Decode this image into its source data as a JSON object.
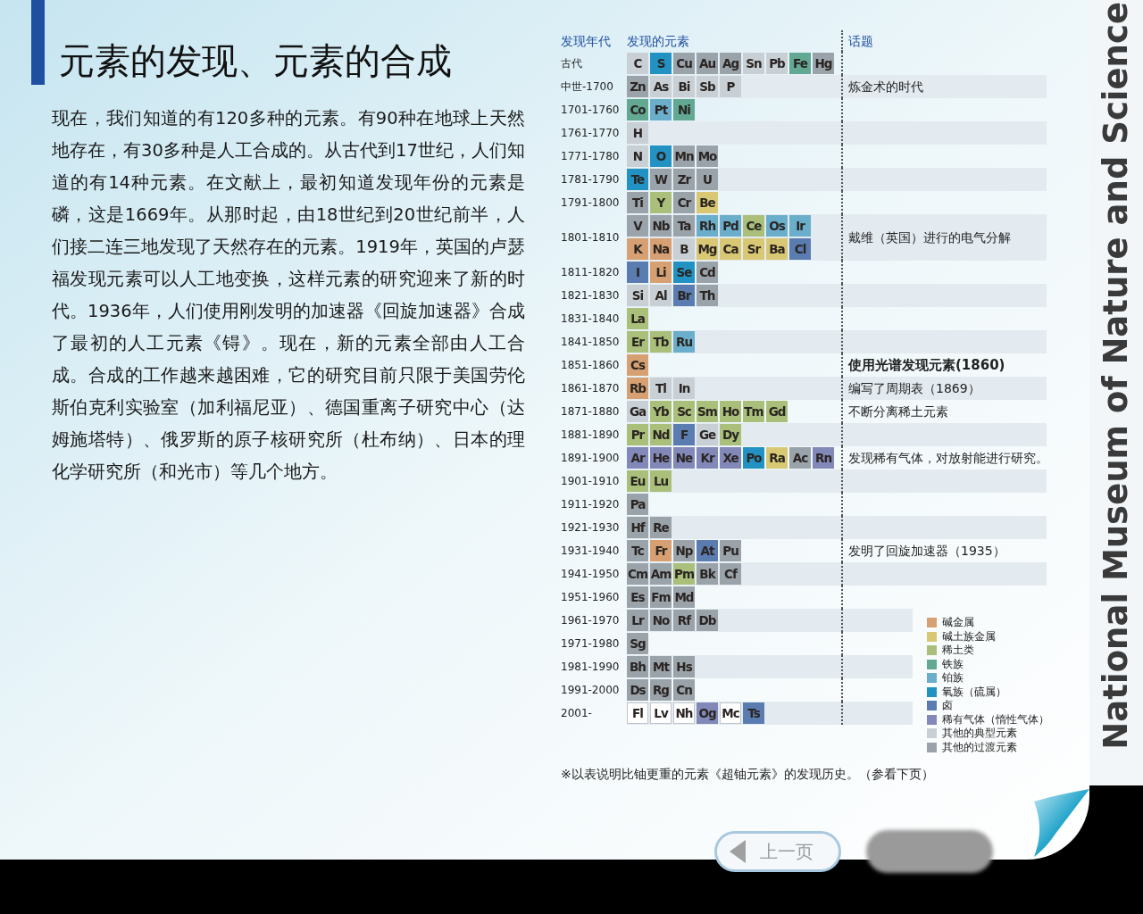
{
  "title": "元素的发现、元素的合成",
  "body": "现在，我们知道的有120多种的元素。有90种在地球上天然地存在，有30多种是人工合成的。从古代到17世纪，人们知道的有14种元素。在文献上，最初知道发现年份的元素是磷，这是1669年。从那时起，由18世纪到20世纪前半，人们接二连三地发现了天然存在的元素。1919年，英国的卢瑟福发现元素可以人工地变换，这样元素的研究迎来了新的时代。1936年，人们使用刚发明的加速器《回旋加速器》合成了最初的人工元素《锝》。现在，新的元素全部由人工合成。合成的工作越来越困难，它的研究目前只限于美国劳伦斯伯克利实验室（加利福尼亚）、德国重离子研究中心（达姆施塔特）、俄罗斯的原子核研究所（杜布纳）、日本的理化学研究所（和光市）等几个地方。",
  "table": {
    "columns": [
      "发现年代",
      "发现的元素",
      "话题"
    ],
    "rows": [
      {
        "era": "古代",
        "lines": [
          [
            {
              "symbol": "C",
              "kind": "typical"
            },
            {
              "symbol": "S",
              "kind": "chalcogen"
            },
            {
              "symbol": "Cu",
              "kind": "transition"
            },
            {
              "symbol": "Au",
              "kind": "transition"
            },
            {
              "symbol": "Ag",
              "kind": "transition"
            },
            {
              "symbol": "Sn",
              "kind": "typical"
            },
            {
              "symbol": "Pb",
              "kind": "typical"
            },
            {
              "symbol": "Fe",
              "kind": "iron"
            },
            {
              "symbol": "Hg",
              "kind": "transition"
            }
          ]
        ]
      },
      {
        "era": "中世-1700",
        "lines": [
          [
            {
              "symbol": "Zn",
              "kind": "transition"
            },
            {
              "symbol": "As",
              "kind": "typical"
            },
            {
              "symbol": "Bi",
              "kind": "typical"
            },
            {
              "symbol": "Sb",
              "kind": "typical"
            },
            {
              "symbol": "P",
              "kind": "typical"
            }
          ]
        ],
        "topic": {
          "text": "炼金术的时代",
          "bold": false
        }
      },
      {
        "era": "1701-1760",
        "lines": [
          [
            {
              "symbol": "Co",
              "kind": "iron"
            },
            {
              "symbol": "Pt",
              "kind": "platinum"
            },
            {
              "symbol": "Ni",
              "kind": "iron"
            }
          ]
        ]
      },
      {
        "era": "1761-1770",
        "lines": [
          [
            {
              "symbol": "H",
              "kind": "typical"
            }
          ]
        ]
      },
      {
        "era": "1771-1780",
        "lines": [
          [
            {
              "symbol": "N",
              "kind": "typical"
            },
            {
              "symbol": "O",
              "kind": "chalcogen"
            },
            {
              "symbol": "Mn",
              "kind": "transition"
            },
            {
              "symbol": "Mo",
              "kind": "transition"
            }
          ]
        ]
      },
      {
        "era": "1781-1790",
        "lines": [
          [
            {
              "symbol": "Te",
              "kind": "chalcogen"
            },
            {
              "symbol": "W",
              "kind": "transition"
            },
            {
              "symbol": "Zr",
              "kind": "transition"
            },
            {
              "symbol": "U",
              "kind": "transition"
            }
          ]
        ]
      },
      {
        "era": "1791-1800",
        "lines": [
          [
            {
              "symbol": "Ti",
              "kind": "transition"
            },
            {
              "symbol": "Y",
              "kind": "rare"
            },
            {
              "symbol": "Cr",
              "kind": "transition"
            },
            {
              "symbol": "Be",
              "kind": "alkaline"
            }
          ]
        ]
      },
      {
        "era": "1801-1810",
        "lines": [
          [
            {
              "symbol": "V",
              "kind": "transition"
            },
            {
              "symbol": "Nb",
              "kind": "transition"
            },
            {
              "symbol": "Ta",
              "kind": "transition"
            },
            {
              "symbol": "Rh",
              "kind": "platinum"
            },
            {
              "symbol": "Pd",
              "kind": "platinum"
            },
            {
              "symbol": "Ce",
              "kind": "rare"
            },
            {
              "symbol": "Os",
              "kind": "platinum"
            },
            {
              "symbol": "Ir",
              "kind": "platinum"
            }
          ],
          [
            {
              "symbol": "K",
              "kind": "alkali"
            },
            {
              "symbol": "Na",
              "kind": "alkali"
            },
            {
              "symbol": "B",
              "kind": "typical"
            },
            {
              "symbol": "Mg",
              "kind": "alkaline"
            },
            {
              "symbol": "Ca",
              "kind": "alkaline"
            },
            {
              "symbol": "Sr",
              "kind": "alkaline"
            },
            {
              "symbol": "Ba",
              "kind": "alkaline"
            },
            {
              "symbol": "Cl",
              "kind": "halogen"
            }
          ]
        ],
        "topic": {
          "text": "戴维（英国）进行的电气分解",
          "bold": false
        }
      },
      {
        "era": "1811-1820",
        "lines": [
          [
            {
              "symbol": "I",
              "kind": "halogen"
            },
            {
              "symbol": "Li",
              "kind": "alkali"
            },
            {
              "symbol": "Se",
              "kind": "chalcogen"
            },
            {
              "symbol": "Cd",
              "kind": "transition"
            }
          ]
        ]
      },
      {
        "era": "1821-1830",
        "lines": [
          [
            {
              "symbol": "Si",
              "kind": "typical"
            },
            {
              "symbol": "Al",
              "kind": "typical"
            },
            {
              "symbol": "Br",
              "kind": "halogen"
            },
            {
              "symbol": "Th",
              "kind": "transition"
            }
          ]
        ]
      },
      {
        "era": "1831-1840",
        "lines": [
          [
            {
              "symbol": "La",
              "kind": "rare"
            }
          ]
        ]
      },
      {
        "era": "1841-1850",
        "lines": [
          [
            {
              "symbol": "Er",
              "kind": "rare"
            },
            {
              "symbol": "Tb",
              "kind": "rare"
            },
            {
              "symbol": "Ru",
              "kind": "platinum"
            }
          ]
        ]
      },
      {
        "era": "1851-1860",
        "lines": [
          [
            {
              "symbol": "Cs",
              "kind": "alkali"
            }
          ]
        ],
        "topic": {
          "text": "使用光谱发现元素(1860)",
          "bold": true
        }
      },
      {
        "era": "1861-1870",
        "lines": [
          [
            {
              "symbol": "Rb",
              "kind": "alkali"
            },
            {
              "symbol": "Tl",
              "kind": "typical"
            },
            {
              "symbol": "In",
              "kind": "typical"
            }
          ]
        ],
        "topic": {
          "text": "编写了周期表（1869）",
          "bold": false
        }
      },
      {
        "era": "1871-1880",
        "lines": [
          [
            {
              "symbol": "Ga",
              "kind": "typical"
            },
            {
              "symbol": "Yb",
              "kind": "rare"
            },
            {
              "symbol": "Sc",
              "kind": "rare"
            },
            {
              "symbol": "Sm",
              "kind": "rare"
            },
            {
              "symbol": "Ho",
              "kind": "rare"
            },
            {
              "symbol": "Tm",
              "kind": "rare"
            },
            {
              "symbol": "Gd",
              "kind": "rare"
            }
          ]
        ],
        "topic": {
          "text": "不断分离稀土元素",
          "bold": false
        }
      },
      {
        "era": "1881-1890",
        "lines": [
          [
            {
              "symbol": "Pr",
              "kind": "rare"
            },
            {
              "symbol": "Nd",
              "kind": "rare"
            },
            {
              "symbol": "F",
              "kind": "halogen"
            },
            {
              "symbol": "Ge",
              "kind": "typical"
            },
            {
              "symbol": "Dy",
              "kind": "rare"
            }
          ]
        ]
      },
      {
        "era": "1891-1900",
        "lines": [
          [
            {
              "symbol": "Ar",
              "kind": "noble"
            },
            {
              "symbol": "He",
              "kind": "noble"
            },
            {
              "symbol": "Ne",
              "kind": "noble"
            },
            {
              "symbol": "Kr",
              "kind": "noble"
            },
            {
              "symbol": "Xe",
              "kind": "noble"
            },
            {
              "symbol": "Po",
              "kind": "chalcogen"
            },
            {
              "symbol": "Ra",
              "kind": "alkaline"
            },
            {
              "symbol": "Ac",
              "kind": "transition"
            },
            {
              "symbol": "Rn",
              "kind": "noble"
            }
          ]
        ],
        "topic": {
          "text": "发现稀有气体，对放射能进行研究。",
          "bold": false
        }
      },
      {
        "era": "1901-1910",
        "lines": [
          [
            {
              "symbol": "Eu",
              "kind": "rare"
            },
            {
              "symbol": "Lu",
              "kind": "rare"
            }
          ]
        ]
      },
      {
        "era": "1911-1920",
        "lines": [
          [
            {
              "symbol": "Pa",
              "kind": "transition"
            }
          ]
        ]
      },
      {
        "era": "1921-1930",
        "lines": [
          [
            {
              "symbol": "Hf",
              "kind": "transition"
            },
            {
              "symbol": "Re",
              "kind": "transition"
            }
          ]
        ]
      },
      {
        "era": "1931-1940",
        "lines": [
          [
            {
              "symbol": "Tc",
              "kind": "transition"
            },
            {
              "symbol": "Fr",
              "kind": "alkali"
            },
            {
              "symbol": "Np",
              "kind": "transition"
            },
            {
              "symbol": "At",
              "kind": "halogen"
            },
            {
              "symbol": "Pu",
              "kind": "transition"
            }
          ]
        ],
        "topic": {
          "text": "发明了回旋加速器（1935）",
          "bold": false
        }
      },
      {
        "era": "1941-1950",
        "lines": [
          [
            {
              "symbol": "Cm",
              "kind": "transition"
            },
            {
              "symbol": "Am",
              "kind": "transition"
            },
            {
              "symbol": "Pm",
              "kind": "rare"
            },
            {
              "symbol": "Bk",
              "kind": "transition"
            },
            {
              "symbol": "Cf",
              "kind": "transition"
            }
          ]
        ]
      },
      {
        "era": "1951-1960",
        "lines": [
          [
            {
              "symbol": "Es",
              "kind": "transition"
            },
            {
              "symbol": "Fm",
              "kind": "transition"
            },
            {
              "symbol": "Md",
              "kind": "transition"
            }
          ]
        ]
      },
      {
        "era": "1961-1970",
        "lines": [
          [
            {
              "symbol": "Lr",
              "kind": "transition"
            },
            {
              "symbol": "No",
              "kind": "transition"
            },
            {
              "symbol": "Rf",
              "kind": "transition"
            },
            {
              "symbol": "Db",
              "kind": "transition"
            }
          ]
        ]
      },
      {
        "era": "1971-1980",
        "lines": [
          [
            {
              "symbol": "Sg",
              "kind": "transition"
            }
          ]
        ]
      },
      {
        "era": "1981-1990",
        "lines": [
          [
            {
              "symbol": "Bh",
              "kind": "transition"
            },
            {
              "symbol": "Mt",
              "kind": "transition"
            },
            {
              "symbol": "Hs",
              "kind": "transition"
            }
          ]
        ]
      },
      {
        "era": "1991-2000",
        "lines": [
          [
            {
              "symbol": "Ds",
              "kind": "transition"
            },
            {
              "symbol": "Rg",
              "kind": "transition"
            },
            {
              "symbol": "Cn",
              "kind": "transition"
            }
          ]
        ]
      },
      {
        "era": "2001-",
        "lines": [
          [
            {
              "symbol": "Fl",
              "kind": "unnamed"
            },
            {
              "symbol": "Lv",
              "kind": "unnamed"
            },
            {
              "symbol": "Nh",
              "kind": "unnamed"
            },
            {
              "symbol": "Og",
              "kind": "noble"
            },
            {
              "symbol": "Mc",
              "kind": "unnamed"
            },
            {
              "symbol": "Ts",
              "kind": "halogen"
            }
          ]
        ]
      }
    ]
  },
  "legend": [
    {
      "label": "碱金属",
      "kind": "alkali",
      "color": "#d6a072"
    },
    {
      "label": "碱土族金属",
      "kind": "alkaline",
      "color": "#d8c874"
    },
    {
      "label": "稀土类",
      "kind": "rare",
      "color": "#aac07a"
    },
    {
      "label": "铁族",
      "kind": "iron",
      "color": "#62a892"
    },
    {
      "label": "铂族",
      "kind": "platinum",
      "color": "#6aaecc"
    },
    {
      "label": "氧族（硫属）",
      "kind": "chalcogen",
      "color": "#2292c2"
    },
    {
      "label": "卤",
      "kind": "halogen",
      "color": "#5a7cb0"
    },
    {
      "label": "稀有气体（惰性气体）",
      "kind": "noble",
      "color": "#8288b8"
    },
    {
      "label": "其他的典型元素",
      "kind": "typical",
      "color": "#c8d0d6"
    },
    {
      "label": "其他的过渡元素",
      "kind": "transition",
      "color": "#9aa2aa"
    }
  ],
  "footnote": "※以表说明比铀更重的元素《超铀元素》的发现历史。（参看下页）",
  "prev_button": {
    "label": "上一页",
    "disabled": false
  },
  "brand": "National Museum of Nature and Science"
}
